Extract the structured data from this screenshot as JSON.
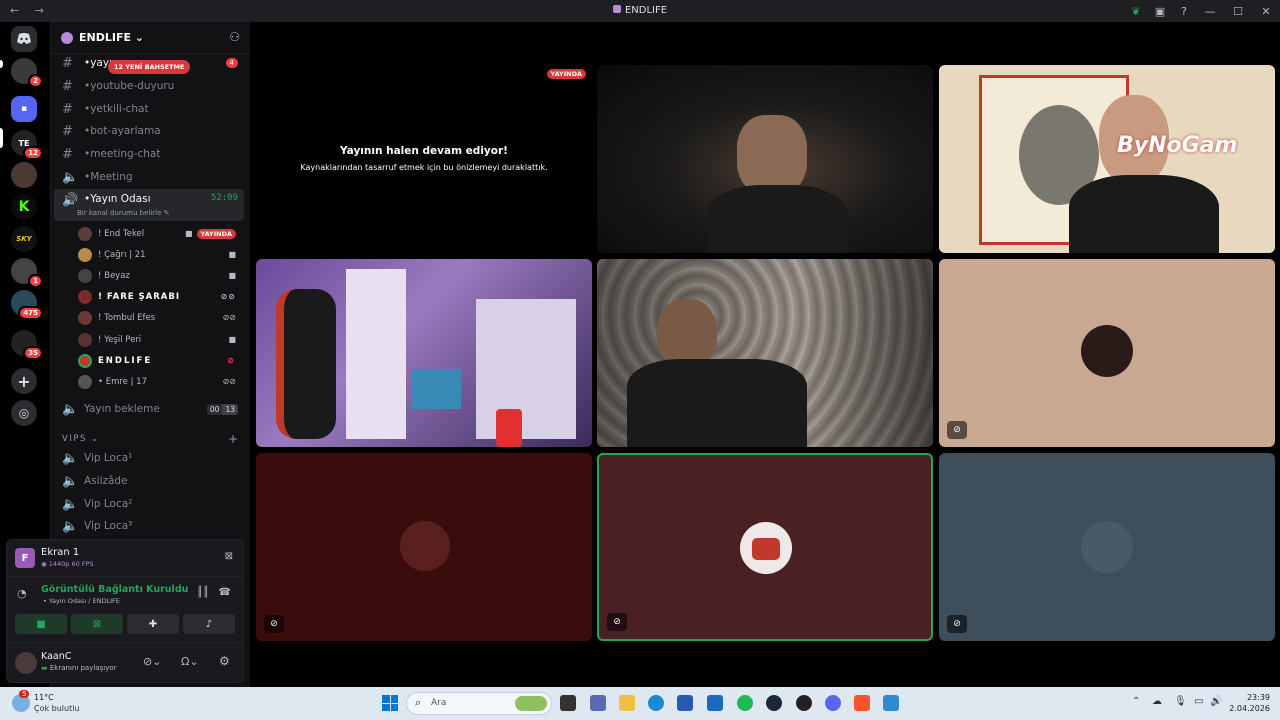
{
  "window": {
    "title": "ENDLIFE",
    "nav_arrows": "←  →",
    "controls": [
      "—",
      "☐",
      "✕"
    ]
  },
  "guild_badges": [
    "2",
    "12",
    "1",
    "475",
    "35"
  ],
  "server": {
    "name": "ENDLIFE ⌄"
  },
  "channels": [
    {
      "label": "yayın",
      "type": "text"
    },
    {
      "label": "youtube-duyuru",
      "type": "text"
    },
    {
      "label": "yetkili-chat",
      "type": "text"
    },
    {
      "label": "bot-ayarlama",
      "type": "text"
    },
    {
      "label": "meeting-chat",
      "type": "text"
    },
    {
      "label": "Meeting",
      "type": "voice"
    },
    {
      "label": "Yayın Odası",
      "type": "voice"
    }
  ],
  "unread_badge": "4",
  "mention_pill": "12 YENİ BAHSETME",
  "active_channel": {
    "timer": "52:09",
    "status_placeholder": "Bir kanal durumu belirle"
  },
  "voice_users": [
    {
      "name": "! End Tekel",
      "live": "YAYINDA",
      "color": "#5c3d3d"
    },
    {
      "name": "! Çağrı | 21",
      "color": "#b98a4a"
    },
    {
      "name": "! Beyaz",
      "color": "#444"
    },
    {
      "name": "! FARE ŞARABI",
      "color": "#7a2a2a"
    },
    {
      "name": "! Tombul Efes",
      "color": "#6a3a3a"
    },
    {
      "name": "! Yeşil Peri",
      "color": "#5a3030"
    },
    {
      "name": "ENDLIFE",
      "color": "#c0392b"
    },
    {
      "name": "• Emre | 17",
      "color": "#555"
    }
  ],
  "more_channels": [
    {
      "label": "Yayın bekleme",
      "counts": [
        "00",
        "13"
      ]
    }
  ],
  "category": {
    "label": "VIPS ⌄",
    "add": "+"
  },
  "vip_channels": [
    "Vip Loca¹",
    "Asilzâde",
    "Vip Loca²",
    "Vip Loca³"
  ],
  "screen_panel": {
    "title": "Ekran 1",
    "quality": "1440p 60 FPS",
    "avatar_letter": "F"
  },
  "connection": {
    "status": "Görüntülü Bağlantı Kuruldu",
    "location": "Yayın Odası / ENDLIFE"
  },
  "user": {
    "name": "KaanC",
    "status": "Ekranını paylaşıyor"
  },
  "stream_paused": {
    "badge": "YAYINDA",
    "title": "Yayının halen devam ediyor!",
    "subtitle": "Kaynaklarından tasarruf etmek için bu önizlemeyi duraklattık."
  },
  "overlay_text": "ByNoGam",
  "taskbar": {
    "weather_temp": "11°C",
    "weather_desc": "Çok bulutlu",
    "weather_badge": "5",
    "search_placeholder": "Ara",
    "time": "23:39",
    "date": "2.04.2026"
  }
}
